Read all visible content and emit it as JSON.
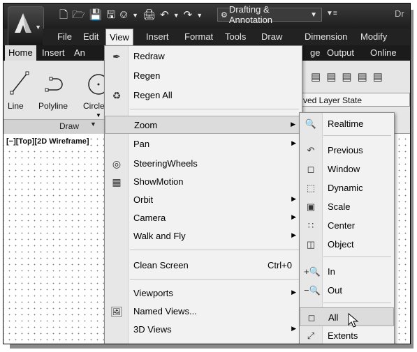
{
  "titlebar": {
    "workspace": "Drafting & Annotation",
    "title_partial": "Dr",
    "qat_icons": [
      "new-icon",
      "open-icon",
      "save-icon",
      "save-as-icon",
      "publish-icon",
      "plot-icon",
      "undo-icon",
      "redo-icon",
      "gear-icon"
    ]
  },
  "menubar": {
    "items": [
      "File",
      "Edit",
      "View",
      "Insert",
      "Format",
      "Tools",
      "Draw",
      "Dimension",
      "Modify"
    ]
  },
  "ribbon": {
    "tabs": [
      "Home",
      "Insert",
      "An",
      "ge",
      "Output",
      "Online"
    ],
    "tools": [
      "Line",
      "Polyline",
      "Circle"
    ],
    "panel_title": "Draw",
    "layer_state": "ved Layer State"
  },
  "viewport": {
    "label": "[−][Top][2D Wireframe]"
  },
  "view_menu": {
    "items": [
      {
        "label": "Redraw",
        "icon": "redraw-icon"
      },
      {
        "label": "Regen",
        "icon": ""
      },
      {
        "label": "Regen All",
        "icon": "regen-all-icon"
      },
      {
        "label": "Zoom",
        "submenu": true
      },
      {
        "label": "Pan",
        "submenu": true
      },
      {
        "label": "SteeringWheels",
        "icon": "steeringwheels-icon"
      },
      {
        "label": "ShowMotion",
        "icon": "showmotion-icon"
      },
      {
        "label": "Orbit",
        "submenu": true
      },
      {
        "label": "Camera",
        "submenu": true
      },
      {
        "label": "Walk and Fly",
        "submenu": true
      },
      {
        "label": "Clean Screen",
        "shortcut": "Ctrl+0"
      },
      {
        "label": "Viewports",
        "submenu": true
      },
      {
        "label": "Named Views...",
        "icon": "named-views-icon"
      },
      {
        "label": "3D Views",
        "submenu": true
      }
    ]
  },
  "zoom_menu": {
    "items": [
      "Realtime",
      "Previous",
      "Window",
      "Dynamic",
      "Scale",
      "Center",
      "Object",
      "In",
      "Out",
      "All",
      "Extents"
    ]
  }
}
